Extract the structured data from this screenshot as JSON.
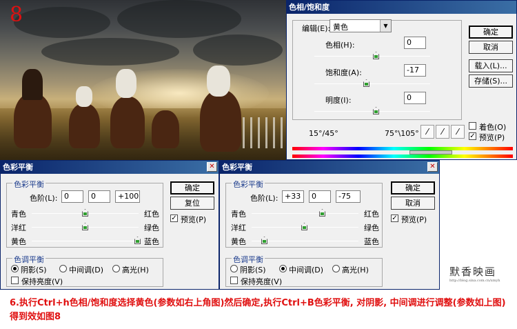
{
  "photo": {
    "step_number": "8"
  },
  "hue_saturation": {
    "title": "色相/饱和度",
    "edit_label": "编辑(E):",
    "edit_value": "黄色",
    "hue_label": "色相(H):",
    "hue_value": "0",
    "saturation_label": "饱和度(A):",
    "saturation_value": "-17",
    "lightness_label": "明度(I):",
    "lightness_value": "0",
    "range_left": "15°/45°",
    "range_right": "75°\\105°",
    "ok": "确定",
    "cancel": "取消",
    "load": "载入(L)...",
    "save": "存储(S)...",
    "colorize": "着色(O)",
    "preview": "预览(P)",
    "colorize_checked": false,
    "preview_checked": true
  },
  "color_balance_left": {
    "title": "色彩平衡",
    "group_label": "色彩平衡",
    "levels_label": "色阶(L):",
    "levels": [
      "0",
      "0",
      "+100"
    ],
    "sliders": [
      {
        "left": "青色",
        "right": "红色",
        "value": 0
      },
      {
        "left": "洋红",
        "right": "绿色",
        "value": 0
      },
      {
        "left": "黄色",
        "right": "蓝色",
        "value": 100
      }
    ],
    "tone_group_label": "色调平衡",
    "tones": [
      "阴影(S)",
      "中间调(D)",
      "高光(H)"
    ],
    "selected_tone": 0,
    "preserve_luminosity": "保持亮度(V)",
    "ok": "确定",
    "reset": "复位",
    "preview": "预览(P)",
    "preview_checked": true
  },
  "color_balance_right": {
    "title": "色彩平衡",
    "group_label": "色彩平衡",
    "levels_label": "色阶(L):",
    "levels": [
      "+33",
      "0",
      "-75"
    ],
    "sliders": [
      {
        "left": "青色",
        "right": "红色",
        "value": 33
      },
      {
        "left": "洋红",
        "right": "绿色",
        "value": 0
      },
      {
        "left": "黄色",
        "right": "蓝色",
        "value": -75
      }
    ],
    "tone_group_label": "色调平衡",
    "tones": [
      "阴影(S)",
      "中间调(D)",
      "高光(H)"
    ],
    "selected_tone": 1,
    "preserve_luminosity": "保持亮度(V)",
    "ok": "确定",
    "cancel": "取消",
    "preview": "预览(P)",
    "preview_checked": true
  },
  "caption": {
    "line1": "6.执行Ctrl+h色相/饱和度选择黄色(参数如右上角图)然后确定,执行Ctrl+B色彩平衡, 对阴影, 中间调进行调整(参数如上图)",
    "line2": "得到效如图8"
  },
  "watermark": {
    "text": "默香映画",
    "url": "http://blog.sina.com.cn/xmyh"
  },
  "colors": {
    "title_start": "#0a246a",
    "title_end": "#3a6ea5",
    "caption": "#e01010",
    "slider_green": "#2e9e2e"
  }
}
